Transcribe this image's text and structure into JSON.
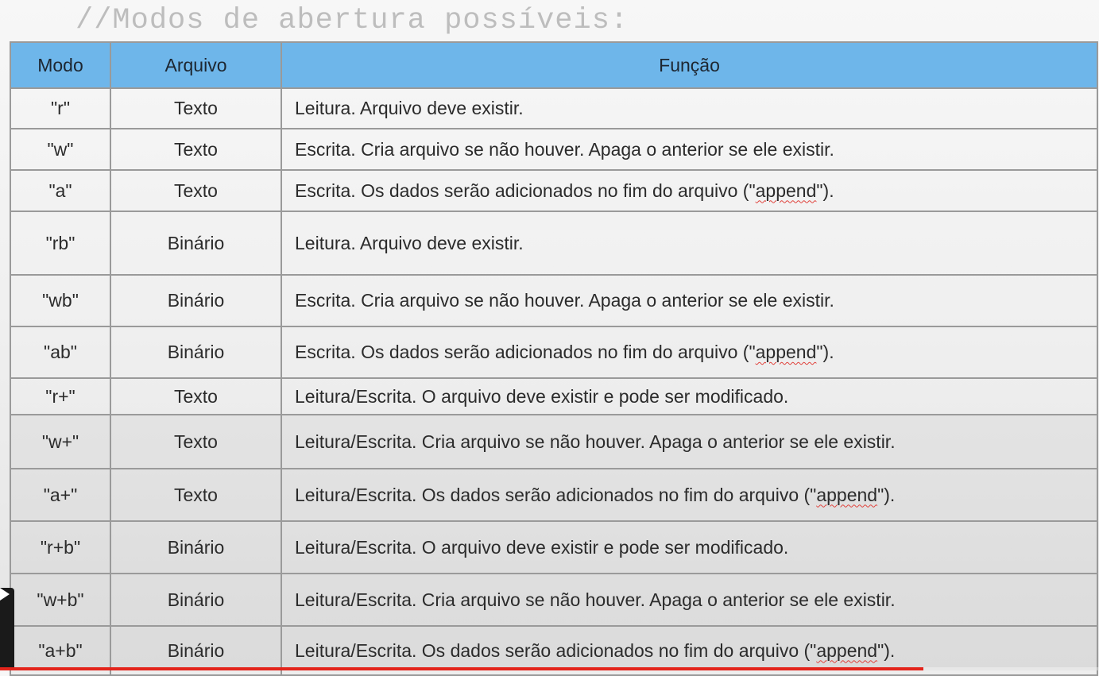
{
  "heading": "//Modos de abertura possíveis:",
  "table": {
    "headers": {
      "mode": "Modo",
      "file": "Arquivo",
      "function": "Função"
    },
    "rows": [
      {
        "mode": "\"r\"",
        "file": "Texto",
        "function": "Leitura. Arquivo deve existir."
      },
      {
        "mode": "\"w\"",
        "file": "Texto",
        "function": "Escrita. Cria arquivo se não houver. Apaga o anterior se ele existir."
      },
      {
        "mode": "\"a\"",
        "file": "Texto",
        "function_before": "Escrita. Os dados serão adicionados no fim do arquivo (\"",
        "function_word": "append",
        "function_after": "\")."
      },
      {
        "mode": "\"rb\"",
        "file": "Binário",
        "function": "Leitura. Arquivo deve existir."
      },
      {
        "mode": "\"wb\"",
        "file": "Binário",
        "function": "Escrita. Cria arquivo se não houver. Apaga o anterior se ele existir."
      },
      {
        "mode": "\"ab\"",
        "file": "Binário",
        "function_before": "Escrita. Os dados serão adicionados no fim do arquivo (\"",
        "function_word": "append",
        "function_after": "\")."
      },
      {
        "mode": "\"r+\"",
        "file": "Texto",
        "function": "Leitura/Escrita. O arquivo deve existir e pode ser modificado."
      },
      {
        "mode": "\"w+\"",
        "file": "Texto",
        "function": "Leitura/Escrita. Cria arquivo se não houver. Apaga o anterior se ele existir."
      },
      {
        "mode": "\"a+\"",
        "file": "Texto",
        "function_before": "Leitura/Escrita. Os dados serão adicionados no fim do arquivo (\"",
        "function_word": "append",
        "function_after": "\")."
      },
      {
        "mode": "\"r+b\"",
        "file": "Binário",
        "function": "Leitura/Escrita. O arquivo deve existir e pode ser modificado."
      },
      {
        "mode": "\"w+b\"",
        "file": "Binário",
        "function": "Leitura/Escrita. Cria arquivo se não houver. Apaga o anterior se ele existir."
      },
      {
        "mode": "\"a+b\"",
        "file": "Binário",
        "function_before": "Leitura/Escrita. Os dados serão adicionados no fim do arquivo (\"",
        "function_word": "append",
        "function_after": "\")."
      }
    ]
  },
  "video": {
    "progress": 0.84,
    "progress_color": "#e3241b",
    "play_icon": "play-icon"
  }
}
